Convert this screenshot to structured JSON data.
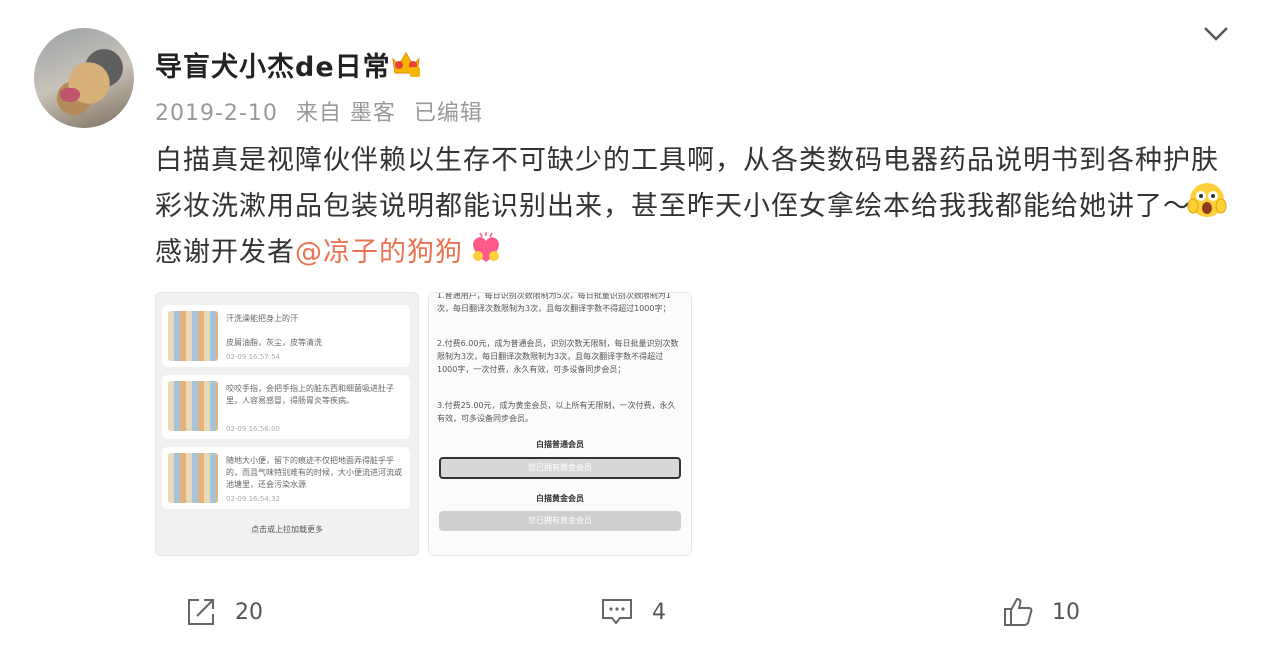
{
  "user": {
    "name": "导盲犬小杰de日常",
    "badge_icon": "crown-badge-icon"
  },
  "meta": {
    "date": "2019-2-10",
    "source": "来自 墨客",
    "edited": "已编辑"
  },
  "post": {
    "line1": "白描真是视障伙伴赖以生存不可缺少的工具啊，从各类数码电器药品说明书到各种护肤",
    "line2": "彩妆洗漱用品包装说明都能识别出来，甚至昨天小侄女拿绘本给我我都能给她讲了～",
    "line3_prefix": "感谢开发者",
    "mention": "@凉子的狗狗"
  },
  "screenshot1": {
    "cards": [
      {
        "text": "汗洗澡能把身上的汗\n\n皮屑油脂，灰尘，皮等清洗",
        "time": "02-09 16:57:54"
      },
      {
        "text": "咬咬手指，会把手指上的脏东西和细菌吸进肚子里，人容易感冒，得肠胃炎等疾病。",
        "time": "02-09 16:56:00"
      },
      {
        "text": "随地大小便，留下的痕迹不仅把地面弄得脏乎乎的，而且气味特别难有的时候，大小便流进河流或池塘里，还会污染水源",
        "time": "02-09 16:54:32"
      }
    ],
    "load_more": "点击或上拉加载更多"
  },
  "screenshot2": {
    "p1": "1.普通用户，每日识别次数限制为5次，每日批量识别次数限制为1次，每日翻译次数限制为3次，且每次翻译字数不得超过1000字；",
    "p2": "2.付费6.00元，成为普通会员，识别次数无限制，每日批量识别次数限制为3次，每日翻译次数限制为3次，且每次翻译字数不得超过1000字，一次付费，永久有效，可多设备同步会员；",
    "p3": "3.付费25.00元，成为黄金会员，以上所有无限制，一次付费，永久有效，可多设备同步会员。",
    "head1": "白描普通会员",
    "btn1": "您已拥有黄金会员",
    "head2": "白描黄金会员",
    "btn2": "您已拥有黄金会员"
  },
  "actions": {
    "repost": "20",
    "comment": "4",
    "like": "10"
  }
}
